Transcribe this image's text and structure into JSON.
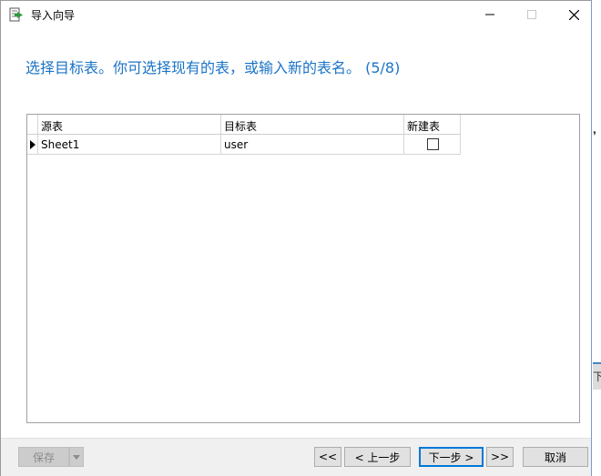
{
  "window": {
    "title": "导入向导",
    "icon": "import-wizard-icon",
    "controls": {
      "minimize": "minimize-icon",
      "maximize": "maximize-icon",
      "close": "close-icon"
    }
  },
  "instruction": "选择目标表。你可选择现有的表，或输入新的表名。 (5/8)",
  "grid": {
    "columns": [
      "源表",
      "目标表",
      "新建表"
    ],
    "rows": [
      {
        "source": "Sheet1",
        "target": "user",
        "create_new": false
      }
    ]
  },
  "footer": {
    "save_label": "保存",
    "first_label": "<<",
    "prev_label": "< 上一步",
    "next_label": "下一步 >",
    "last_label": ">>",
    "cancel_label": "取消"
  },
  "background": {
    "mark_top": "❜",
    "mark_bottom": "下"
  },
  "colors": {
    "instruction_text": "#1b74c7",
    "default_button_border": "#0078d7",
    "footer_bg": "#f0f0f0"
  }
}
